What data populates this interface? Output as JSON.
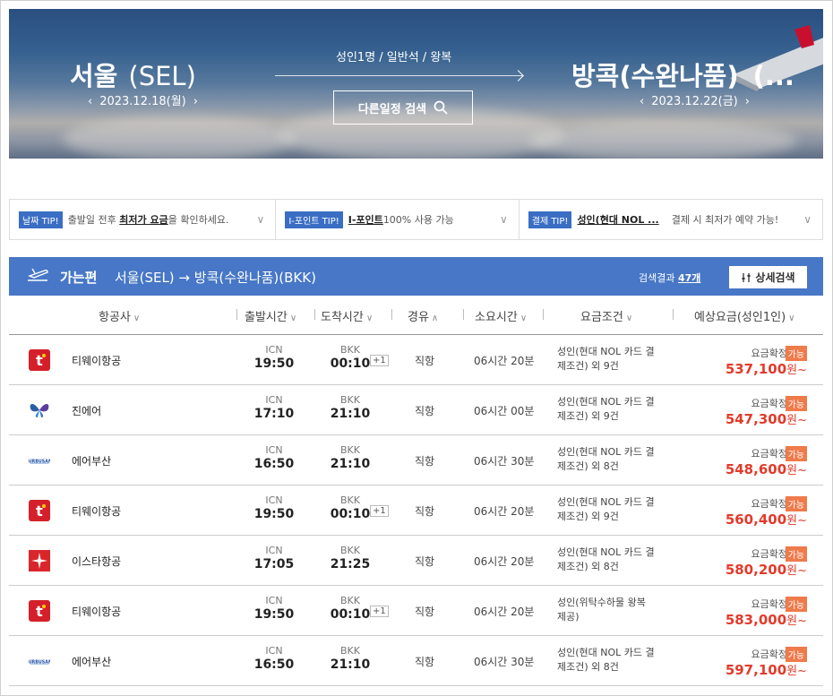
{
  "search": {
    "from_city": "서울",
    "from_code": "(SEL)",
    "from_date": "2023.12.18(월)",
    "to_city": "방콕(수완나품)",
    "to_suffix": "(...",
    "to_date": "2023.12.22(금)",
    "passengers": "성인1명 / 일반석 / 왕복",
    "alt_search_label": "다른일정 검색"
  },
  "tips": [
    {
      "badge": "날짜 TIP!",
      "pre": "출발일 전후 ",
      "bold": "최저가 요금",
      "post": "을 확인하세요."
    },
    {
      "badge": "I-포인트 TIP!",
      "pre": "",
      "bold": "I-포인트",
      "post": " 100% 사용 가능"
    },
    {
      "badge": "결제 TIP!",
      "pre": "",
      "bold": "성인(현대 NOL ...",
      "post": "결제 시 최저가 예약 가능!"
    }
  ],
  "results": {
    "label": "가는편",
    "route": "서울(SEL) → 방콕(수완나품)(BKK)",
    "count_prefix": "검색결과 ",
    "count": "47개",
    "detail_button": "상세검색"
  },
  "columns": {
    "airline": "항공사",
    "departure": "출발시간",
    "arrival": "도착시간",
    "stops": "경유",
    "duration": "소요시간",
    "conditions": "요금조건",
    "price": "예상요금(성인1인)"
  },
  "flights": [
    {
      "airline": "티웨이항공",
      "logo": "tway-logo-icon",
      "dep_code": "ICN",
      "dep_time": "19:50",
      "arr_code": "BKK",
      "arr_time": "00:10",
      "plus": "+1",
      "stops": "직항",
      "duration": "06시간 20분",
      "cond1": "성인(현대 NOL 카드 결",
      "cond2": "제조건) 외 ",
      "cond_count": "9건",
      "confirm": "요금확정",
      "avail": "가능",
      "price": "537,100",
      "won": "원~"
    },
    {
      "airline": "진에어",
      "logo": "jinair-logo-icon",
      "dep_code": "ICN",
      "dep_time": "17:10",
      "arr_code": "BKK",
      "arr_time": "21:10",
      "plus": "",
      "stops": "직항",
      "duration": "06시간 00분",
      "cond1": "성인(현대 NOL 카드 결",
      "cond2": "제조건) 외 ",
      "cond_count": "9건",
      "confirm": "요금확정",
      "avail": "가능",
      "price": "547,300",
      "won": "원~"
    },
    {
      "airline": "에어부산",
      "logo": "airbusan-logo-icon",
      "dep_code": "ICN",
      "dep_time": "16:50",
      "arr_code": "BKK",
      "arr_time": "21:10",
      "plus": "",
      "stops": "직항",
      "duration": "06시간 30분",
      "cond1": "성인(현대 NOL 카드 결",
      "cond2": "제조건) 외 ",
      "cond_count": "8건",
      "confirm": "요금확정",
      "avail": "가능",
      "price": "548,600",
      "won": "원~"
    },
    {
      "airline": "티웨이항공",
      "logo": "tway-logo-icon",
      "dep_code": "ICN",
      "dep_time": "19:50",
      "arr_code": "BKK",
      "arr_time": "00:10",
      "plus": "+1",
      "stops": "직항",
      "duration": "06시간 20분",
      "cond1": "성인(현대 NOL 카드 결",
      "cond2": "제조건) 외 ",
      "cond_count": "9건",
      "confirm": "요금확정",
      "avail": "가능",
      "price": "560,400",
      "won": "원~"
    },
    {
      "airline": "이스타항공",
      "logo": "eastar-logo-icon",
      "dep_code": "ICN",
      "dep_time": "17:05",
      "arr_code": "BKK",
      "arr_time": "21:25",
      "plus": "",
      "stops": "직항",
      "duration": "06시간 20분",
      "cond1": "성인(현대 NOL 카드 결",
      "cond2": "제조건) 외 ",
      "cond_count": "8건",
      "confirm": "요금확정",
      "avail": "가능",
      "price": "580,200",
      "won": "원~"
    },
    {
      "airline": "티웨이항공",
      "logo": "tway-logo-icon",
      "dep_code": "ICN",
      "dep_time": "19:50",
      "arr_code": "BKK",
      "arr_time": "00:10",
      "plus": "+1",
      "stops": "직항",
      "duration": "06시간 20분",
      "cond1": "성인(위탁수하물 왕복",
      "cond2": "제공)",
      "cond_count": "",
      "confirm": "요금확정",
      "avail": "가능",
      "price": "583,000",
      "won": "원~"
    },
    {
      "airline": "에어부산",
      "logo": "airbusan-logo-icon",
      "dep_code": "ICN",
      "dep_time": "16:50",
      "arr_code": "BKK",
      "arr_time": "21:10",
      "plus": "",
      "stops": "직항",
      "duration": "06시간 30분",
      "cond1": "성인(현대 NOL 카드 결",
      "cond2": "제조건) 외 ",
      "cond_count": "8건",
      "confirm": "요금확정",
      "avail": "가능",
      "price": "597,100",
      "won": "원~"
    }
  ],
  "colors": {
    "accent": "#4777c6",
    "price": "#e23b2b",
    "badge": "#ef7a4a",
    "tip_badge": "#3a6ec4"
  }
}
